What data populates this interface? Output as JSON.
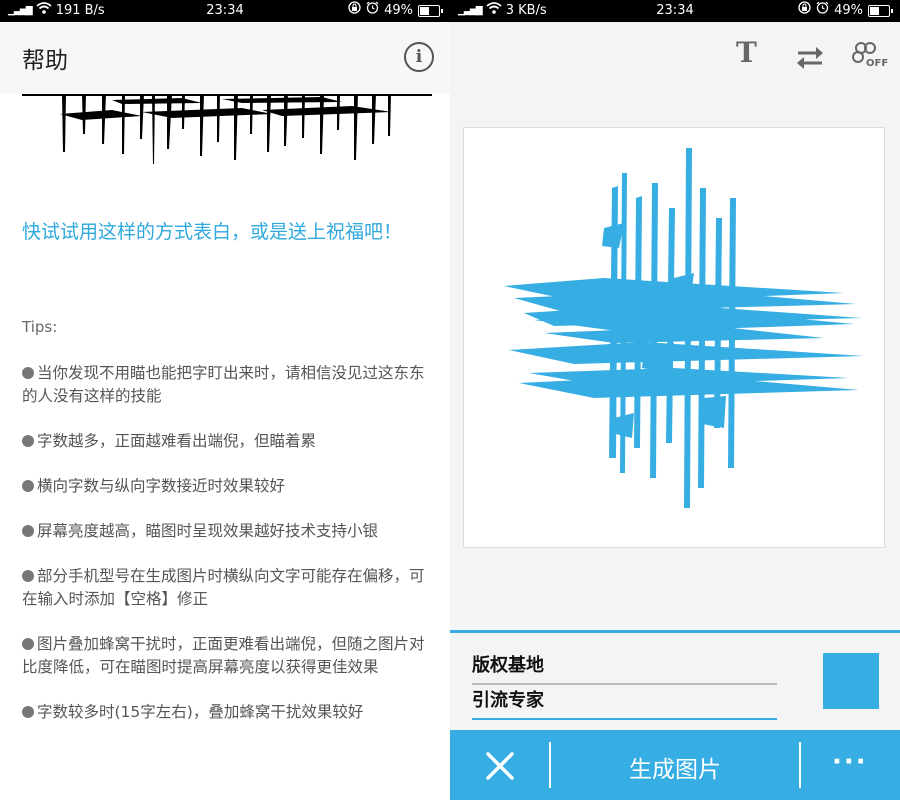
{
  "left": {
    "status": {
      "net_speed": "191 B/s",
      "time": "23:34",
      "battery": "49%",
      "battery_level": 0.49
    },
    "appbar": {
      "title": "帮助"
    },
    "prompt": "快试试用这样的方式表白，或是送上祝福吧！",
    "tips_heading": "Tips:",
    "tips": [
      "当你发现不用瞄也能把字盯出来时，请相信没见过这东东的人没有这样的技能",
      "字数越多，正面越难看出端倪，但瞄着累",
      "横向字数与纵向字数接近时效果较好",
      "屏幕亮度越高，瞄图时呈现效果越好技术支持小银",
      "部分手机型号在生成图片时横纵向文字可能存在偏移，可在输入时添加【空格】修正",
      "图片叠加蜂窝干扰时，正面更难看出端倪，但随之图片对比度降低，可在瞄图时提高屏幕亮度以获得更佳效果",
      "字数较多时(15字左右)，叠加蜂窝干扰效果较好"
    ]
  },
  "right": {
    "status": {
      "net_speed": "3 KB/s",
      "time": "23:34",
      "battery": "49%",
      "battery_level": 0.49
    },
    "toolbar": {
      "text_icon": "T",
      "honeycomb_label": "OFF"
    },
    "inputs": {
      "line1": "版权基地",
      "line2": "引流专家"
    },
    "accent_color": "#37aee3",
    "bottom": {
      "generate_label": "生成图片",
      "more_label": "···"
    }
  }
}
